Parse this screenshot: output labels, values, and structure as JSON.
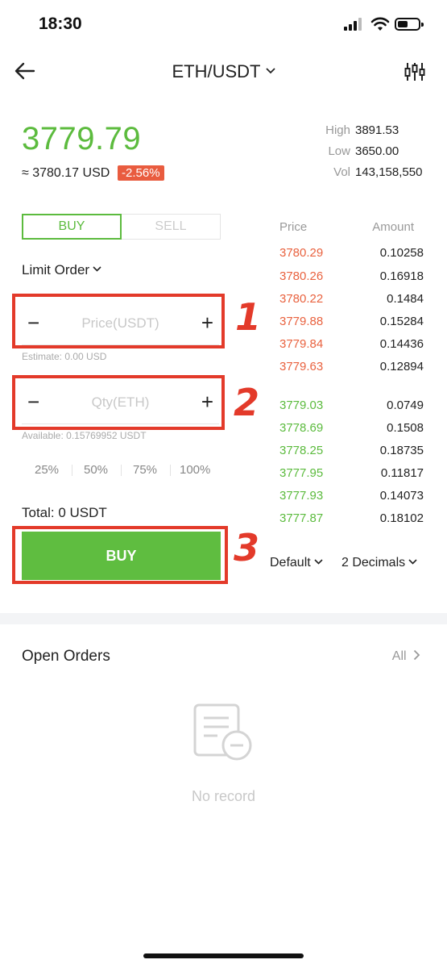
{
  "status_bar": {
    "time": "18:30"
  },
  "header": {
    "pair": "ETH/USDT"
  },
  "ticker": {
    "price": "3779.79",
    "usd_equiv": "≈ 3780.17 USD",
    "change": "-2.56%",
    "stats": [
      {
        "label": "High",
        "value": "3891.53"
      },
      {
        "label": "Low",
        "value": "3650.00"
      },
      {
        "label": "Vol",
        "value": "143,158,550"
      }
    ]
  },
  "trade": {
    "tab_buy": "BUY",
    "tab_sell": "SELL",
    "order_type": "Limit Order",
    "price_placeholder": "Price(USDT)",
    "estimate": "Estimate: 0.00 USD",
    "qty_placeholder": "Qty(ETH)",
    "available": "Available: 0.15769952 USDT",
    "percents": [
      "25%",
      "50%",
      "75%",
      "100%"
    ],
    "total": "Total: 0 USDT",
    "buy_button": "BUY",
    "step_marks": [
      "1",
      "2",
      "3"
    ]
  },
  "order_book": {
    "price_header": "Price",
    "amount_header": "Amount",
    "asks": [
      {
        "price": "3780.29",
        "amount": "0.10258"
      },
      {
        "price": "3780.26",
        "amount": "0.16918"
      },
      {
        "price": "3780.22",
        "amount": "0.1484"
      },
      {
        "price": "3779.88",
        "amount": "0.15284"
      },
      {
        "price": "3779.84",
        "amount": "0.14436"
      },
      {
        "price": "3779.63",
        "amount": "0.12894"
      }
    ],
    "bids": [
      {
        "price": "3779.03",
        "amount": "0.0749"
      },
      {
        "price": "3778.69",
        "amount": "0.1508"
      },
      {
        "price": "3778.25",
        "amount": "0.18735"
      },
      {
        "price": "3777.95",
        "amount": "0.11817"
      },
      {
        "price": "3777.93",
        "amount": "0.14073"
      },
      {
        "price": "3777.87",
        "amount": "0.18102"
      }
    ],
    "depth_select": "Default",
    "decimals_select": "2 Decimals"
  },
  "open_orders": {
    "title": "Open Orders",
    "all_link": "All",
    "empty": "No record"
  },
  "colors": {
    "green": "#5cbb3e",
    "red": "#e9623f",
    "annotation_red": "#e33a2a"
  },
  "icons": [
    "back-arrow-icon",
    "chevron-down-icon",
    "candlestick-settings-icon",
    "chevron-right-icon",
    "empty-document-icon",
    "signal-icon",
    "wifi-icon",
    "battery-icon"
  ]
}
